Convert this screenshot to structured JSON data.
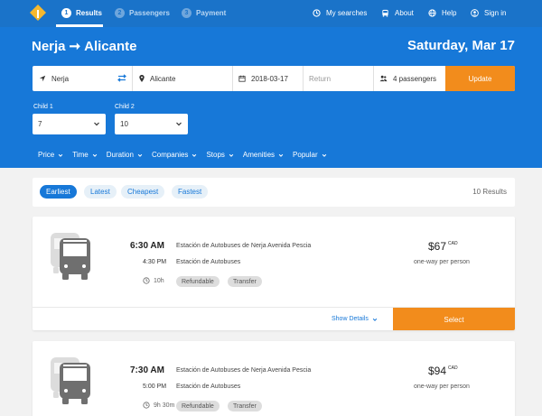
{
  "nav": {
    "steps": [
      {
        "num": "1",
        "label": "Results"
      },
      {
        "num": "2",
        "label": "Passengers"
      },
      {
        "num": "3",
        "label": "Payment"
      }
    ],
    "links": {
      "my_searches": "My searches",
      "about": "About",
      "help": "Help",
      "sign_in": "Sign in"
    }
  },
  "header": {
    "origin": "Nerja",
    "arrow": "➞",
    "destination": "Alicante",
    "date": "Saturday, Mar 17"
  },
  "search": {
    "from": "Nerja",
    "to": "Alicante",
    "departure": "2018-03-17",
    "return_placeholder": "Return",
    "passengers": "4 passengers",
    "update_label": "Update"
  },
  "children": [
    {
      "label": "Child 1",
      "value": "7"
    },
    {
      "label": "Child 2",
      "value": "10"
    }
  ],
  "filters": [
    "Price",
    "Time",
    "Duration",
    "Companies",
    "Stops",
    "Amenities",
    "Popular"
  ],
  "sort": {
    "options": [
      "Earliest",
      "Latest",
      "Cheapest",
      "Fastest"
    ],
    "active": "Earliest",
    "results_count": "10 Results"
  },
  "results": [
    {
      "departure_time": "6:30 AM",
      "departure_station": "Estación de Autobuses de Nerja Avenida Pescia",
      "arrival_time": "4:30 PM",
      "arrival_station": "Estación de Autobuses",
      "duration": "10h",
      "tags": [
        "Refundable",
        "Transfer"
      ],
      "price": "$67",
      "currency": "CAD",
      "price_note": "one-way per person",
      "show_details": "Show Details",
      "select_label": "Select"
    },
    {
      "departure_time": "7:30 AM",
      "departure_station": "Estación de Autobuses de Nerja Avenida Pescia",
      "arrival_time": "5:00 PM",
      "arrival_station": "Estación de Autobuses",
      "duration": "9h 30m",
      "tags": [
        "Refundable",
        "Transfer"
      ],
      "price": "$94",
      "currency": "CAD",
      "price_note": "one-way per person"
    }
  ],
  "colors": {
    "brand_blue": "#1778d8",
    "nav_blue": "#1a73c9",
    "accent_orange": "#f28c1c",
    "logo_yellow": "#f5b82e"
  },
  "icons": [
    "logo-icon",
    "history-icon",
    "bus-icon",
    "globe-icon",
    "user-icon",
    "navigation-arrow-icon",
    "swap-icon",
    "map-pin-icon",
    "calendar-icon",
    "people-icon",
    "chevron-down-icon",
    "clock-icon"
  ]
}
